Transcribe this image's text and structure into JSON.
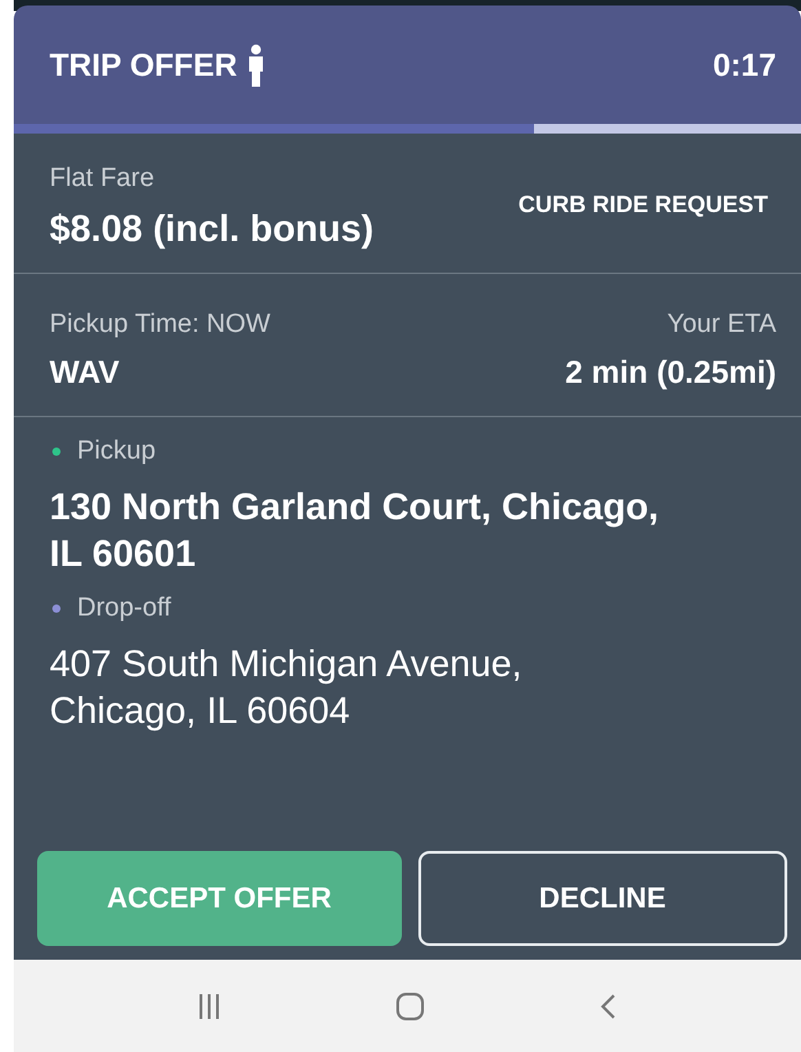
{
  "header": {
    "title": "TRIP OFFER",
    "timer": "0:17",
    "level": 0.66
  },
  "fare": {
    "label": "Flat Fare",
    "amount": "$8.08 (incl. bonus)",
    "request_type": "CURB RIDE REQUEST"
  },
  "pickup_info": {
    "time_label": "Pickup Time: NOW",
    "vehicle": "WAV",
    "eta_label": "Your ETA",
    "eta": "2 min (0.25mi)"
  },
  "stops": [
    {
      "label": "Pickup",
      "color": "#2ec48a",
      "address": "130 North Garland Court, Chicago, IL 60601",
      "emphasis": true
    },
    {
      "label": "Drop-off",
      "color": "#8c8fd6",
      "address": "407 South Michigan Avenue, Chicago, IL 60604",
      "emphasis": false
    }
  ],
  "buttons": [
    {
      "label": "ACCEPT OFFER",
      "kind": "primary"
    },
    {
      "label": "DECLINE",
      "kind": "outline"
    }
  ]
}
